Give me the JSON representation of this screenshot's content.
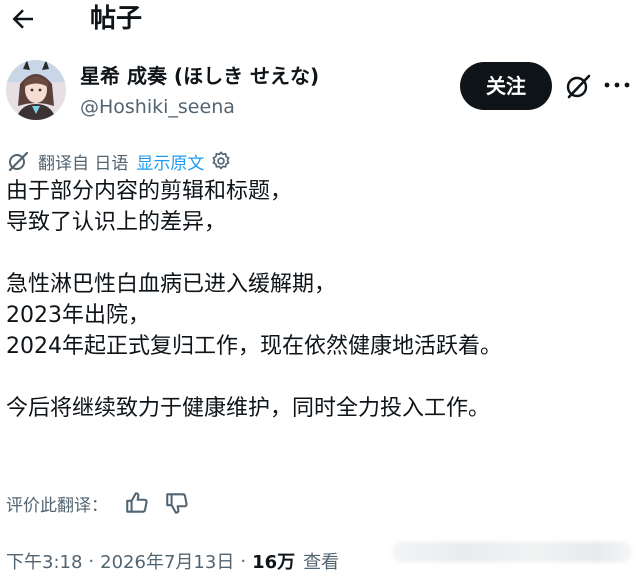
{
  "header": {
    "title": "帖子"
  },
  "author": {
    "name": "星希 成奏 (ほしき せえな)",
    "handle": "@Hoshiki_seena",
    "follow_label": "关注"
  },
  "translation": {
    "label": "翻译自 日语",
    "show_original": "显示原文"
  },
  "post": {
    "lines": [
      "由于部分内容的剪辑和标题，",
      "导致了认识上的差异，",
      "",
      "急性淋巴性白血病已进入缓解期，",
      "2023年出院，",
      "2024年起正式复归工作，现在依然健康地活跃着。",
      "",
      "今后将继续致力于健康维护，同时全力投入工作。"
    ]
  },
  "rate": {
    "label": "评价此翻译："
  },
  "meta": {
    "time": "下午3:18",
    "date": "2026年7月13日",
    "separator": "·",
    "views_count": "16万",
    "views_label": "查看"
  },
  "colors": {
    "text": "#0f1419",
    "secondary": "#536471",
    "link": "#1d9bf0",
    "button_bg": "#0f1419"
  }
}
